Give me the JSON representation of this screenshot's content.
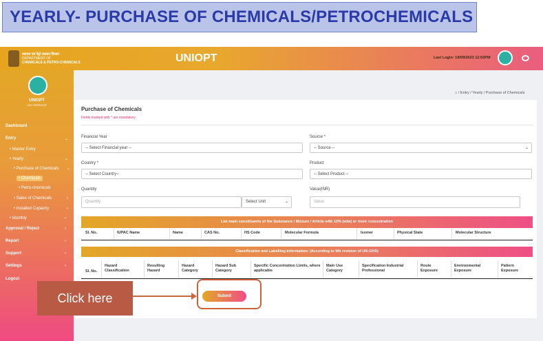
{
  "banner": {
    "title": "YEARLY- PURCHASE OF CHEMICALS/PETROCHEMICALS"
  },
  "header": {
    "dept_line1": "रसायन एवं पेट्रो रसायन विभाग",
    "dept_line2": "DEPARTMENT OF",
    "dept_line3": "CHEMICALS & PETRO-CHEMICALS",
    "app_name": "UNIOPT",
    "last_login": "Last Login: 19/09/2023 12:02PM"
  },
  "sidebar": {
    "user_name": "UNIOPT",
    "user_role": "UNIT OPERATOR",
    "items": [
      {
        "label": "Dashboard"
      },
      {
        "label": "Entry"
      },
      {
        "label": "• Master Entry"
      },
      {
        "label": "• Yearly"
      },
      {
        "label": "• Purchase of Chemicals"
      },
      {
        "label": "• Chemicals"
      },
      {
        "label": "• Petro-chemicals"
      },
      {
        "label": "• Sales of Chemicals"
      },
      {
        "label": "• Installed Capacity"
      },
      {
        "label": "• Monthly"
      },
      {
        "label": "Approval / Reject"
      },
      {
        "label": "Report"
      },
      {
        "label": "Support"
      },
      {
        "label": "Settings"
      },
      {
        "label": "Logout"
      }
    ]
  },
  "breadcrumb": "Entry / Yearly / Purchase of Chemicals",
  "form": {
    "title": "Purchase of Chemicals",
    "mandatory_note": "Fields marked with * are mandatory",
    "financial_year_label": "Financial Year",
    "financial_year_value": "-- Select Financial year --",
    "source_label": "Source *",
    "source_value": "-- Source --",
    "country_label": "Country *",
    "country_value": "-- Select Country--",
    "product_label": "Product",
    "product_value": "-- Select Product --",
    "quantity_label": "Quantity",
    "quantity_placeholder": "Quantity",
    "unit_value": "Select Unit",
    "value_label": "Value(INR)",
    "value_placeholder": "Value"
  },
  "table1": {
    "title": "List main constituents of the Substance / Mixture / Article with 10% (w/w) or more concentration",
    "headers": [
      "Sl. No.",
      "IUPAC Name",
      "Name",
      "CAS No.",
      "HS Code",
      "Molecular Formula",
      "Isomer",
      "Physical State",
      "Molecular Structure"
    ]
  },
  "table2": {
    "title": "Classification and Labelling Information: (According to 9th revision of UN-GHS)",
    "headers": [
      "Sl. No.",
      "Hazard Classification",
      "Resulting Hazard",
      "Hazard Category",
      "Hazard Sub Category",
      "Specific Concentration Limits, where applicable",
      "Main Use Category",
      "Specification Industrial Professional",
      "Route Exposure",
      "Environmental Exposure",
      "Pattern Exposure"
    ]
  },
  "submit_label": "Submit",
  "callout": "Click here"
}
